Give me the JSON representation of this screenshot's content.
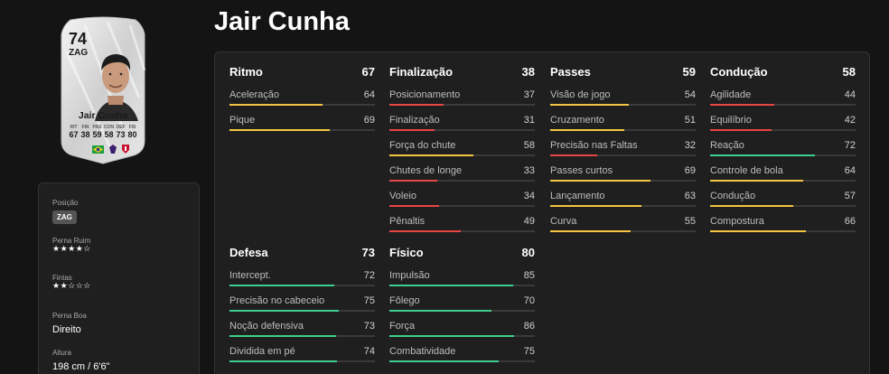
{
  "player": {
    "name": "Jair Cunha",
    "rating": "74",
    "position": "ZAG"
  },
  "card": {
    "name": "Jair Cunha",
    "stats": [
      {
        "label": "RIT",
        "value": "67"
      },
      {
        "label": "FIN",
        "value": "38"
      },
      {
        "label": "PAS",
        "value": "59"
      },
      {
        "label": "CON",
        "value": "58"
      },
      {
        "label": "DEF",
        "value": "73"
      },
      {
        "label": "FIS",
        "value": "80"
      }
    ]
  },
  "info": {
    "position_label": "Posição",
    "position_value": "ZAG",
    "weak_foot_label": "Perna Ruim",
    "weak_foot_stars": "★★★★☆",
    "skills_label": "Fintas",
    "skills_stars": "★★☆☆☆",
    "preferred_foot_label": "Perna Boa",
    "preferred_foot_value": "Direito",
    "height_label": "Altura",
    "height_value": "198 cm / 6'6\""
  },
  "colors": {
    "high": "#3ecf8e",
    "mid": "#f5c542",
    "low": "#e84545"
  },
  "groups": [
    {
      "name": "Ritmo",
      "value": "67",
      "attributes": [
        {
          "name": "Aceleração",
          "value": "64"
        },
        {
          "name": "Pique",
          "value": "69"
        }
      ]
    },
    {
      "name": "Finalização",
      "value": "38",
      "attributes": [
        {
          "name": "Posicionamento",
          "value": "37"
        },
        {
          "name": "Finalização",
          "value": "31"
        },
        {
          "name": "Força do chute",
          "value": "58"
        },
        {
          "name": "Chutes de longe",
          "value": "33"
        },
        {
          "name": "Voleio",
          "value": "34"
        },
        {
          "name": "Pênaltis",
          "value": "49"
        }
      ]
    },
    {
      "name": "Passes",
      "value": "59",
      "attributes": [
        {
          "name": "Visão de jogo",
          "value": "54"
        },
        {
          "name": "Cruzamento",
          "value": "51"
        },
        {
          "name": "Precisão nas Faltas",
          "value": "32"
        },
        {
          "name": "Passes curtos",
          "value": "69"
        },
        {
          "name": "Lançamento",
          "value": "63"
        },
        {
          "name": "Curva",
          "value": "55"
        }
      ]
    },
    {
      "name": "Condução",
      "value": "58",
      "attributes": [
        {
          "name": "Agilidade",
          "value": "44"
        },
        {
          "name": "Equilíbrio",
          "value": "42"
        },
        {
          "name": "Reação",
          "value": "72"
        },
        {
          "name": "Controle de bola",
          "value": "64"
        },
        {
          "name": "Condução",
          "value": "57"
        },
        {
          "name": "Compostura",
          "value": "66"
        }
      ]
    },
    {
      "name": "Defesa",
      "value": "73",
      "attributes": [
        {
          "name": "Intercept.",
          "value": "72"
        },
        {
          "name": "Precisão no cabeceio",
          "value": "75"
        },
        {
          "name": "Noção defensiva",
          "value": "73"
        },
        {
          "name": "Dividida em pé",
          "value": "74"
        }
      ]
    },
    {
      "name": "Físico",
      "value": "80",
      "attributes": [
        {
          "name": "Impulsão",
          "value": "85"
        },
        {
          "name": "Fôlego",
          "value": "70"
        },
        {
          "name": "Força",
          "value": "86"
        },
        {
          "name": "Combatividade",
          "value": "75"
        }
      ]
    }
  ]
}
